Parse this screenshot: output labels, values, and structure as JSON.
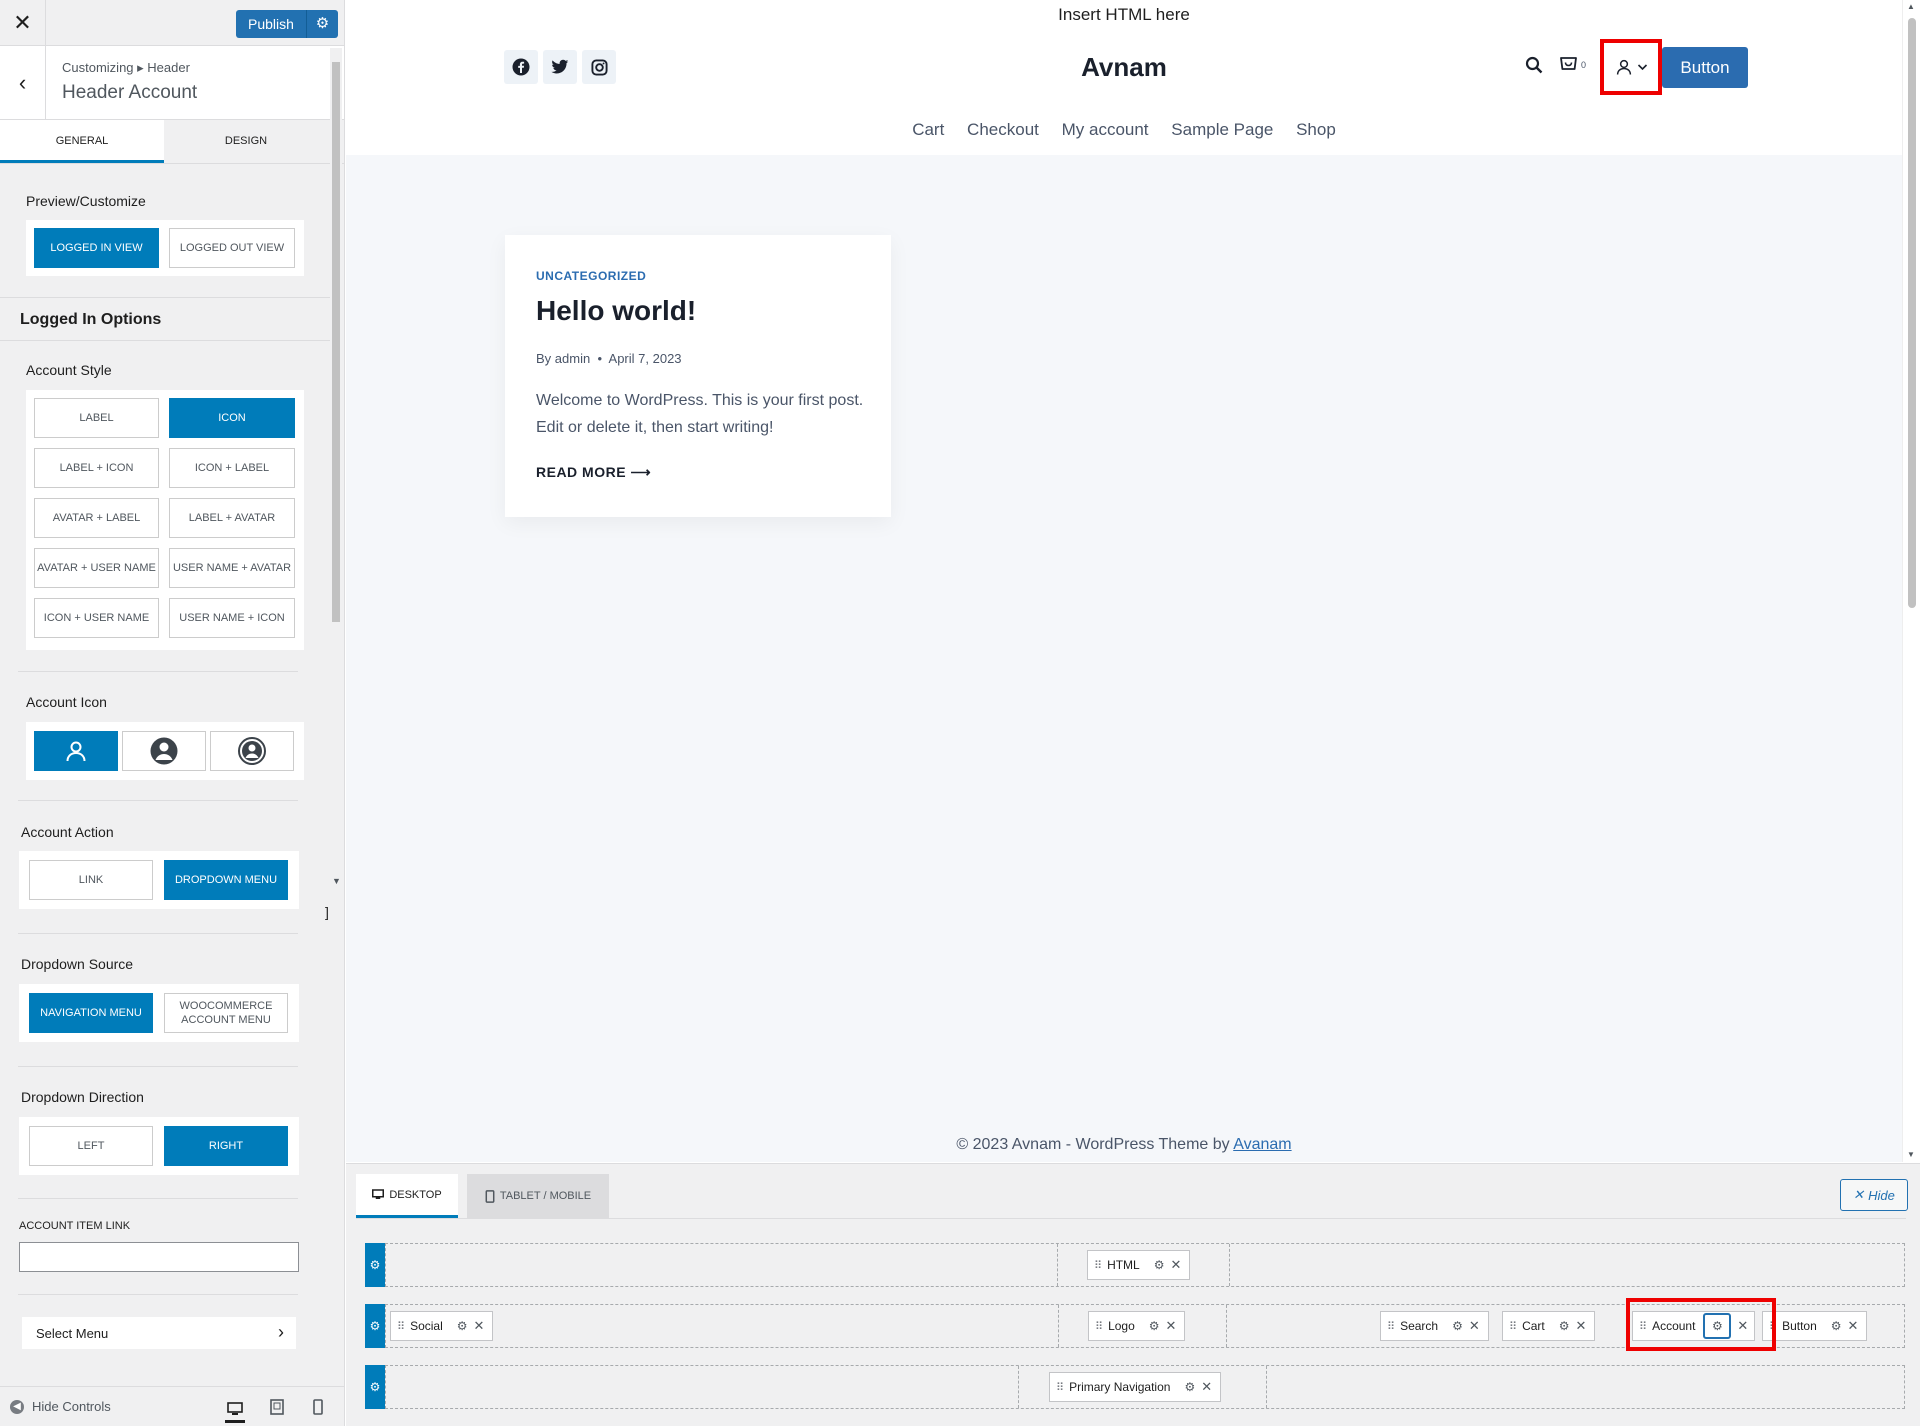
{
  "sidebar": {
    "publish_label": "Publish",
    "breadcrumb": "Customizing ▸ Header",
    "panel_title": "Header Account",
    "tabs": [
      "GENERAL",
      "DESIGN"
    ],
    "preview_label": "Preview/Customize",
    "preview_options": [
      "LOGGED IN VIEW",
      "LOGGED OUT VIEW"
    ],
    "logged_in_heading": "Logged In Options",
    "account_style_label": "Account Style",
    "account_style_options": [
      "LABEL",
      "ICON",
      "LABEL + ICON",
      "ICON + LABEL",
      "AVATAR + LABEL",
      "LABEL + AVATAR",
      "AVATAR + USER NAME",
      "USER NAME + AVATAR",
      "ICON + USER NAME",
      "USER NAME + ICON"
    ],
    "account_icon_label": "Account Icon",
    "account_action_label": "Account Action",
    "account_action_options": [
      "LINK",
      "DROPDOWN MENU"
    ],
    "dropdown_source_label": "Dropdown Source",
    "dropdown_source_options": [
      "NAVIGATION MENU",
      "WOOCOMMERCE ACCOUNT MENU"
    ],
    "dropdown_direction_label": "Dropdown Direction",
    "dropdown_direction_options": [
      "LEFT",
      "RIGHT"
    ],
    "item_link_label": "ACCOUNT ITEM LINK",
    "item_link_value": "",
    "select_menu_label": "Select Menu",
    "hide_controls_label": "Hide Controls"
  },
  "preview": {
    "html_text": "Insert HTML here",
    "site_title": "Avnam",
    "cart_count": "0",
    "button_label": "Button",
    "nav_items": [
      "Cart",
      "Checkout",
      "My account",
      "Sample Page",
      "Shop"
    ],
    "post": {
      "category": "UNCATEGORIZED",
      "title": "Hello world!",
      "by": "By",
      "author": "admin",
      "date": "April 7, 2023",
      "excerpt": "Welcome to WordPress. This is your first post. Edit or delete it, then start writing!",
      "read_more": "READ MORE"
    },
    "footer_text": "© 2023 Avnam - WordPress Theme by",
    "footer_link": "Avanam"
  },
  "builder": {
    "tabs": [
      "DESKTOP",
      "TABLET / MOBILE"
    ],
    "hide_label": "Hide",
    "top_row": [
      "HTML"
    ],
    "main_row": [
      "Social",
      "Logo",
      "Search",
      "Cart",
      "Account",
      "Button"
    ],
    "bottom_row": [
      "Primary Navigation"
    ]
  },
  "colors": {
    "accent": "#007cba",
    "site_button": "#2b6cb0",
    "highlight": "#ee0000"
  }
}
